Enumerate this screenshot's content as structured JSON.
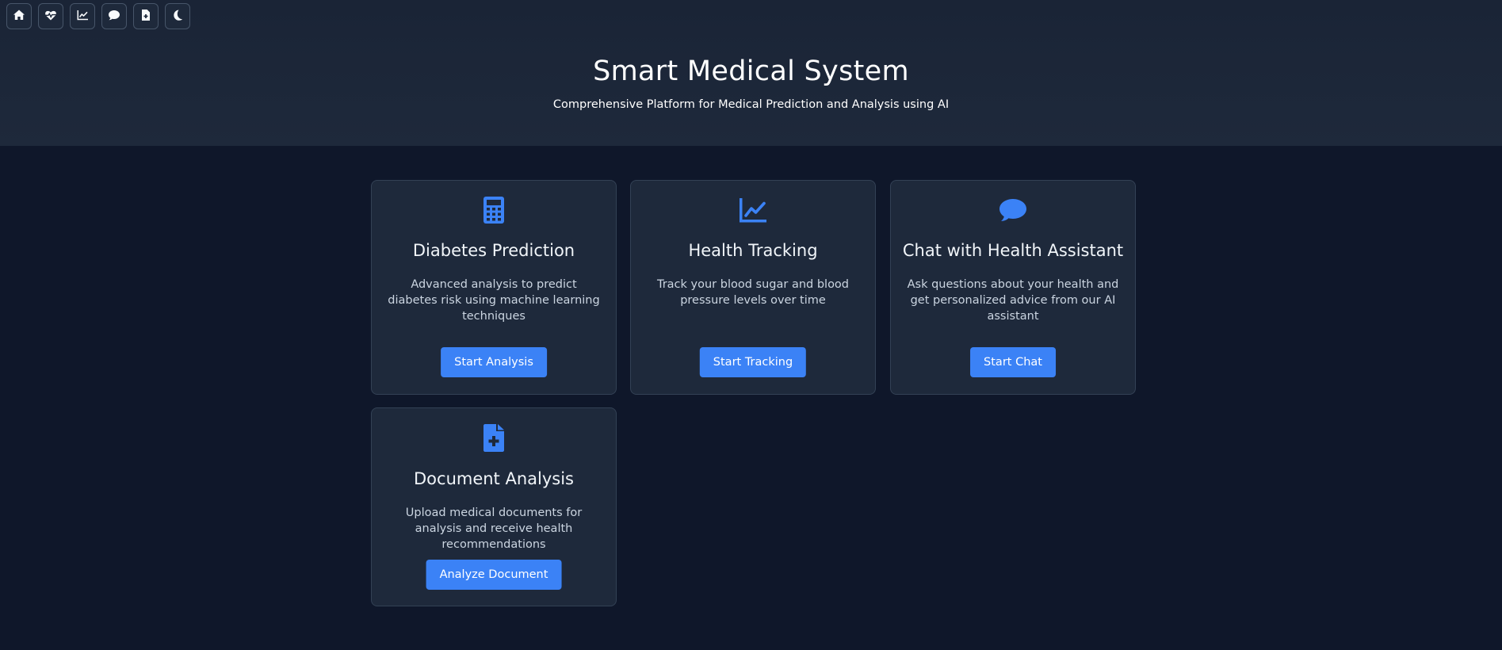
{
  "nav": {
    "icons": [
      "home-icon",
      "heart-pulse-icon",
      "chart-line-icon",
      "comment-icon",
      "file-medical-icon",
      "moon-icon"
    ]
  },
  "header": {
    "title": "Smart Medical System",
    "subtitle": "Comprehensive Platform for Medical Prediction and Analysis using AI"
  },
  "cards": [
    {
      "icon": "calculator-icon",
      "title": "Diabetes Prediction",
      "description": "Advanced analysis to predict diabetes risk using machine learning techniques",
      "button": "Start Analysis"
    },
    {
      "icon": "chart-line-icon",
      "title": "Health Tracking",
      "description": "Track your blood sugar and blood pressure levels over time",
      "button": "Start Tracking"
    },
    {
      "icon": "comment-icon",
      "title": "Chat with Health Assistant",
      "description": "Ask questions about your health and get personalized advice from our AI assistant",
      "button": "Start Chat"
    },
    {
      "icon": "file-medical-icon",
      "title": "Document Analysis",
      "description": "Upload medical documents for analysis and receive health recommendations",
      "button": "Analyze Document"
    }
  ],
  "colors": {
    "background": "#0f172a",
    "card": "#1e293b",
    "accent": "#3b82f6",
    "text": "#f1f5f9"
  }
}
